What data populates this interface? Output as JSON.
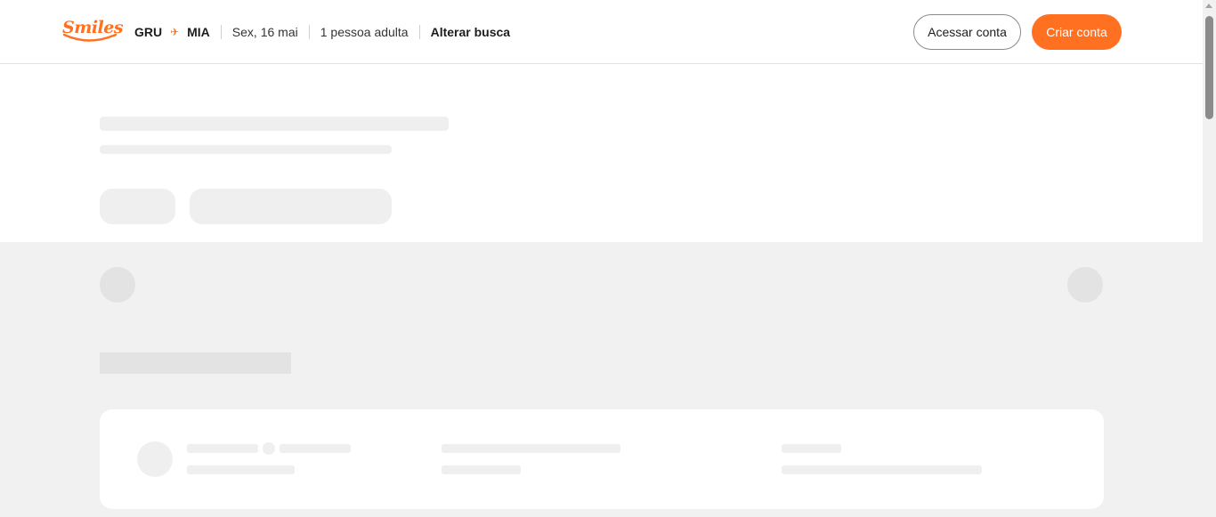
{
  "header": {
    "logo_text": "Smiles",
    "origin": "GRU",
    "destination": "MIA",
    "date": "Sex, 16 mai",
    "passengers": "1 pessoa adulta",
    "alter_search": "Alterar busca",
    "login_button": "Acessar conta",
    "create_button": "Criar conta"
  },
  "colors": {
    "brand_orange": "#ff7020",
    "skeleton": "#efefef",
    "skeleton_dark": "#e3e3e3",
    "section_bg": "#f1f1f1"
  },
  "icons": {
    "route_separator": "plane-icon"
  }
}
